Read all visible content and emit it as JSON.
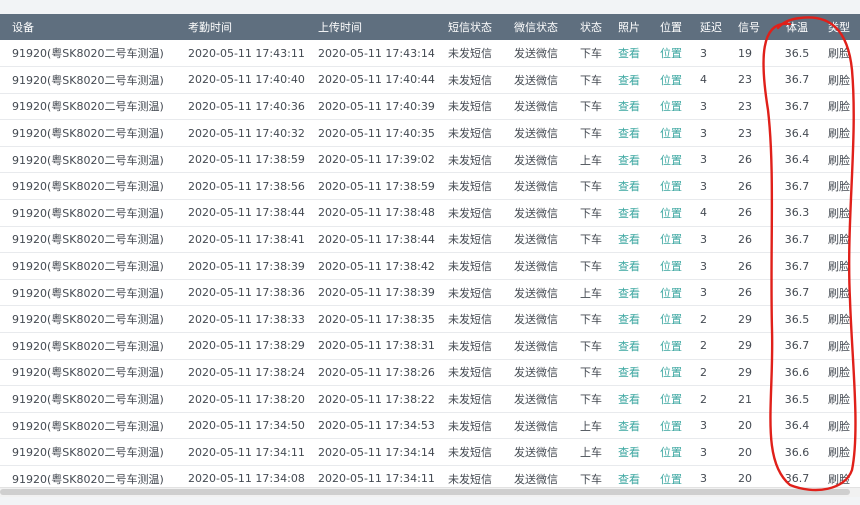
{
  "columns": [
    "设备",
    "考勤时间",
    "上传时间",
    "短信状态",
    "微信状态",
    "状态",
    "照片",
    "位置",
    "延迟",
    "信号",
    "体温",
    "类型"
  ],
  "rows": [
    {
      "device": "91920(粤SK8020二号车测温)",
      "attendance_time": "2020-05-11 17:43:11",
      "upload_time": "2020-05-11 17:43:14",
      "sms_status": "未发短信",
      "wechat_status": "发送微信",
      "status": "下车",
      "photo": "查看",
      "location": "位置",
      "delay": "3",
      "signal": "19",
      "temperature": "36.5",
      "type": "刷脸"
    },
    {
      "device": "91920(粤SK8020二号车测温)",
      "attendance_time": "2020-05-11 17:40:40",
      "upload_time": "2020-05-11 17:40:44",
      "sms_status": "未发短信",
      "wechat_status": "发送微信",
      "status": "下车",
      "photo": "查看",
      "location": "位置",
      "delay": "4",
      "signal": "23",
      "temperature": "36.7",
      "type": "刷脸"
    },
    {
      "device": "91920(粤SK8020二号车测温)",
      "attendance_time": "2020-05-11 17:40:36",
      "upload_time": "2020-05-11 17:40:39",
      "sms_status": "未发短信",
      "wechat_status": "发送微信",
      "status": "下车",
      "photo": "查看",
      "location": "位置",
      "delay": "3",
      "signal": "23",
      "temperature": "36.7",
      "type": "刷脸"
    },
    {
      "device": "91920(粤SK8020二号车测温)",
      "attendance_time": "2020-05-11 17:40:32",
      "upload_time": "2020-05-11 17:40:35",
      "sms_status": "未发短信",
      "wechat_status": "发送微信",
      "status": "下车",
      "photo": "查看",
      "location": "位置",
      "delay": "3",
      "signal": "23",
      "temperature": "36.4",
      "type": "刷脸"
    },
    {
      "device": "91920(粤SK8020二号车测温)",
      "attendance_time": "2020-05-11 17:38:59",
      "upload_time": "2020-05-11 17:39:02",
      "sms_status": "未发短信",
      "wechat_status": "发送微信",
      "status": "上车",
      "photo": "查看",
      "location": "位置",
      "delay": "3",
      "signal": "26",
      "temperature": "36.4",
      "type": "刷脸"
    },
    {
      "device": "91920(粤SK8020二号车测温)",
      "attendance_time": "2020-05-11 17:38:56",
      "upload_time": "2020-05-11 17:38:59",
      "sms_status": "未发短信",
      "wechat_status": "发送微信",
      "status": "下车",
      "photo": "查看",
      "location": "位置",
      "delay": "3",
      "signal": "26",
      "temperature": "36.7",
      "type": "刷脸"
    },
    {
      "device": "91920(粤SK8020二号车测温)",
      "attendance_time": "2020-05-11 17:38:44",
      "upload_time": "2020-05-11 17:38:48",
      "sms_status": "未发短信",
      "wechat_status": "发送微信",
      "status": "下车",
      "photo": "查看",
      "location": "位置",
      "delay": "4",
      "signal": "26",
      "temperature": "36.3",
      "type": "刷脸"
    },
    {
      "device": "91920(粤SK8020二号车测温)",
      "attendance_time": "2020-05-11 17:38:41",
      "upload_time": "2020-05-11 17:38:44",
      "sms_status": "未发短信",
      "wechat_status": "发送微信",
      "status": "下车",
      "photo": "查看",
      "location": "位置",
      "delay": "3",
      "signal": "26",
      "temperature": "36.7",
      "type": "刷脸"
    },
    {
      "device": "91920(粤SK8020二号车测温)",
      "attendance_time": "2020-05-11 17:38:39",
      "upload_time": "2020-05-11 17:38:42",
      "sms_status": "未发短信",
      "wechat_status": "发送微信",
      "status": "下车",
      "photo": "查看",
      "location": "位置",
      "delay": "3",
      "signal": "26",
      "temperature": "36.7",
      "type": "刷脸"
    },
    {
      "device": "91920(粤SK8020二号车测温)",
      "attendance_time": "2020-05-11 17:38:36",
      "upload_time": "2020-05-11 17:38:39",
      "sms_status": "未发短信",
      "wechat_status": "发送微信",
      "status": "上车",
      "photo": "查看",
      "location": "位置",
      "delay": "3",
      "signal": "26",
      "temperature": "36.7",
      "type": "刷脸"
    },
    {
      "device": "91920(粤SK8020二号车测温)",
      "attendance_time": "2020-05-11 17:38:33",
      "upload_time": "2020-05-11 17:38:35",
      "sms_status": "未发短信",
      "wechat_status": "发送微信",
      "status": "下车",
      "photo": "查看",
      "location": "位置",
      "delay": "2",
      "signal": "29",
      "temperature": "36.5",
      "type": "刷脸"
    },
    {
      "device": "91920(粤SK8020二号车测温)",
      "attendance_time": "2020-05-11 17:38:29",
      "upload_time": "2020-05-11 17:38:31",
      "sms_status": "未发短信",
      "wechat_status": "发送微信",
      "status": "下车",
      "photo": "查看",
      "location": "位置",
      "delay": "2",
      "signal": "29",
      "temperature": "36.7",
      "type": "刷脸"
    },
    {
      "device": "91920(粤SK8020二号车测温)",
      "attendance_time": "2020-05-11 17:38:24",
      "upload_time": "2020-05-11 17:38:26",
      "sms_status": "未发短信",
      "wechat_status": "发送微信",
      "status": "下车",
      "photo": "查看",
      "location": "位置",
      "delay": "2",
      "signal": "29",
      "temperature": "36.6",
      "type": "刷脸"
    },
    {
      "device": "91920(粤SK8020二号车测温)",
      "attendance_time": "2020-05-11 17:38:20",
      "upload_time": "2020-05-11 17:38:22",
      "sms_status": "未发短信",
      "wechat_status": "发送微信",
      "status": "下车",
      "photo": "查看",
      "location": "位置",
      "delay": "2",
      "signal": "21",
      "temperature": "36.5",
      "type": "刷脸"
    },
    {
      "device": "91920(粤SK8020二号车测温)",
      "attendance_time": "2020-05-11 17:34:50",
      "upload_time": "2020-05-11 17:34:53",
      "sms_status": "未发短信",
      "wechat_status": "发送微信",
      "status": "上车",
      "photo": "查看",
      "location": "位置",
      "delay": "3",
      "signal": "20",
      "temperature": "36.4",
      "type": "刷脸"
    },
    {
      "device": "91920(粤SK8020二号车测温)",
      "attendance_time": "2020-05-11 17:34:11",
      "upload_time": "2020-05-11 17:34:14",
      "sms_status": "未发短信",
      "wechat_status": "发送微信",
      "status": "上车",
      "photo": "查看",
      "location": "位置",
      "delay": "3",
      "signal": "20",
      "temperature": "36.6",
      "type": "刷脸"
    },
    {
      "device": "91920(粤SK8020二号车测温)",
      "attendance_time": "2020-05-11 17:34:08",
      "upload_time": "2020-05-11 17:34:11",
      "sms_status": "未发短信",
      "wechat_status": "发送微信",
      "status": "下车",
      "photo": "查看",
      "location": "位置",
      "delay": "3",
      "signal": "20",
      "temperature": "36.7",
      "type": "刷脸"
    }
  ],
  "colors": {
    "header_bg": "#5f6f7f",
    "header_text": "#ffffff",
    "link": "#3aa6a0",
    "cell_text": "#444a52",
    "annotation_red": "#e0201a"
  }
}
